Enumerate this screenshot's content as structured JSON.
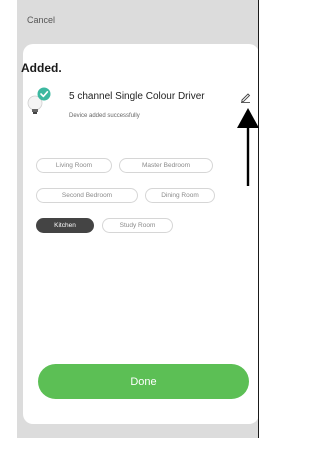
{
  "header": {
    "cancel_label": "Cancel"
  },
  "sheet": {
    "title": "Added."
  },
  "device": {
    "name": "5 channel Single Colour Driver",
    "status": "Device added successfully",
    "icon": "bulb-icon",
    "status_icon": "check-icon",
    "edit_icon": "pencil-icon"
  },
  "rooms": [
    {
      "label": "Living Room",
      "selected": false
    },
    {
      "label": "Master Bedroom",
      "selected": false
    },
    {
      "label": "Second Bedroom",
      "selected": false
    },
    {
      "label": "Dining Room",
      "selected": false
    },
    {
      "label": "Kitchen",
      "selected": true
    },
    {
      "label": "Study Room",
      "selected": false
    }
  ],
  "footer": {
    "done_label": "Done"
  },
  "colors": {
    "accent": "#5cbf55",
    "check": "#3cb8a0",
    "selected_chip": "#444444"
  }
}
